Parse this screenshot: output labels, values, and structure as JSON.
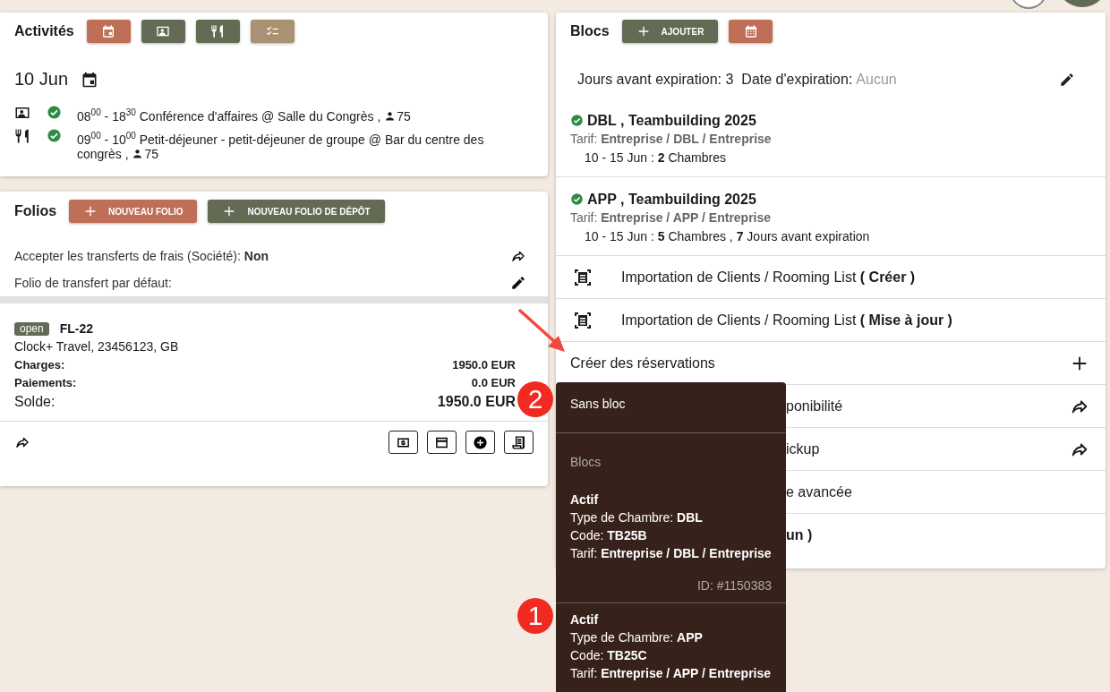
{
  "activities": {
    "title": "Activités",
    "buttons": [
      {
        "kind": "calendar",
        "color": "#bf6f57"
      },
      {
        "kind": "presentation",
        "color": "#636b54"
      },
      {
        "kind": "dining",
        "color": "#636b54"
      },
      {
        "kind": "checklist",
        "color": "#a99273"
      }
    ],
    "date": "10 Jun",
    "events": [
      {
        "kind": "presentation",
        "confirmed": true,
        "text": "08$^{00}$ - 18$^{30}$ Conférence d'affaires @ Salle du Congrès , ",
        "guests": "75"
      },
      {
        "kind": "dining",
        "confirmed": true,
        "text": "09$^{00}$ - 10$^{00}$ Petit-déjeuner - petit-déjeuner de groupe @ Bar du centre des congrès , ",
        "guests": "75"
      }
    ]
  },
  "folios": {
    "title": "Folios",
    "buttons": [
      {
        "label": "NOUVEAU FOLIO",
        "color": "#bf6f57"
      },
      {
        "label": "NOUVEAU FOLIO DE DÉPÔT",
        "color": "#636b54"
      }
    ],
    "settings": [
      {
        "kind": "transfer",
        "text": "Accepter les transferts de frais (Société): **Non**"
      },
      {
        "kind": "editable",
        "text": "Folio de transfert par défaut:"
      }
    ],
    "folio": {
      "status": "open",
      "number": "FL-22",
      "client": "Clock+ Travel, 23456123, GB",
      "lines": [
        {
          "kind": "normal",
          "label": "Charges:",
          "value": "1950.0 EUR"
        },
        {
          "kind": "normal",
          "label": "Paiements:",
          "value": "0.0 EUR"
        },
        {
          "kind": "total",
          "label": "Solde:",
          "value": "1950.0 EUR"
        }
      ],
      "tools": [
        {
          "kind": "money"
        },
        {
          "kind": "card"
        },
        {
          "kind": "add"
        },
        {
          "kind": "receipt"
        }
      ]
    }
  },
  "blocks": {
    "title": "Blocs",
    "add_button": "AJOUTER",
    "expiration": {
      "days": "Jours avant expiration: 3",
      "date_label": "Date d'expiration:",
      "date": "Aucun"
    },
    "items": [
      {
        "confirmed": true,
        "title": "DBL , Teambuilding 2025",
        "rate": "Tarif: **Entreprise / DBL / Entreprise**",
        "dates": "10 - 15 Jun : **2** Chambres"
      },
      {
        "confirmed": true,
        "title": "APP , Teambuilding 2025",
        "rate": "Tarif: **Entreprise / APP / Entreprise**",
        "dates": "10 - 15 Jun : **5** Chambres , **7** Jours avant expiration"
      }
    ],
    "actions": [
      {
        "kind": "import",
        "text": "Importation de Clients / Rooming List **( Créer )**"
      },
      {
        "kind": "import",
        "text": "Importation de Clients / Rooming List **( Mise à jour )**"
      },
      {
        "kind": "create",
        "text": "Créer des réservations"
      },
      {
        "kind": "hidden_link",
        "text": "ponibilité"
      },
      {
        "kind": "hidden_link",
        "text": "ickup"
      },
      {
        "kind": "covered",
        "text": "e avancée"
      },
      {
        "kind": "covered",
        "text": "un )",
        "bold": true
      }
    ]
  },
  "menu": {
    "items": [
      {
        "kind": "option",
        "text": "Sans bloc"
      },
      {
        "kind": "header",
        "text": "Blocs"
      },
      {
        "kind": "block",
        "status": "Actif",
        "lines": [
          "Type de Chambre: **DBL**",
          "Code: **TB25B**",
          "Tarif: **Entreprise / DBL / Entreprise**"
        ],
        "id": "ID: #1150383"
      },
      {
        "kind": "block",
        "status": "Actif",
        "lines": [
          "Type de Chambre: **APP**",
          "Code: **TB25C**",
          "Tarif: **Entreprise / APP / Entreprise**"
        ]
      }
    ]
  },
  "annotations": [
    {
      "kind": "arrow"
    },
    {
      "kind": "number",
      "text": "2"
    },
    {
      "kind": "number",
      "text": "1"
    }
  ]
}
